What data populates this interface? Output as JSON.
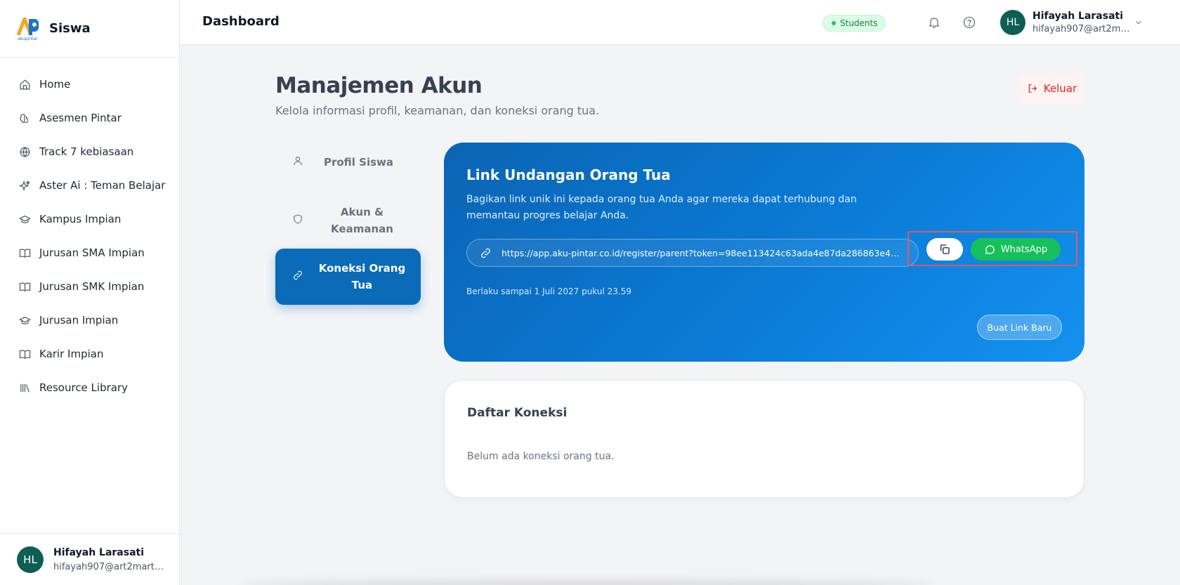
{
  "brand": {
    "name": "Siswa",
    "logo_text": "akupintar"
  },
  "sidebar": {
    "items": [
      {
        "label": "Home",
        "icon": "home-icon"
      },
      {
        "label": "Asesmen Pintar",
        "icon": "brain-icon"
      },
      {
        "label": "Track 7 kebiasaan",
        "icon": "globe-icon"
      },
      {
        "label": "Aster Ai : Teman Belajar",
        "icon": "sparkles-icon"
      },
      {
        "label": "Kampus Impian",
        "icon": "graduation-cap-icon"
      },
      {
        "label": "Jurusan SMA Impian",
        "icon": "book-icon"
      },
      {
        "label": "Jurusan SMK Impian",
        "icon": "book-icon"
      },
      {
        "label": "Jurusan Impian",
        "icon": "graduation-cap-icon"
      },
      {
        "label": "Karir Impian",
        "icon": "book-icon"
      },
      {
        "label": "Resource Library",
        "icon": "library-icon"
      }
    ],
    "user": {
      "initials": "HL",
      "name": "Hifayah Larasati",
      "email": "hifayah907@art2mart.c..."
    }
  },
  "header": {
    "title": "Dashboard",
    "role": "Students",
    "user": {
      "initials": "HL",
      "name": "Hifayah Larasati",
      "email": "hifayah907@art2mar..."
    }
  },
  "page": {
    "title": "Manajemen Akun",
    "subtitle": "Kelola informasi profil, keamanan, dan koneksi orang tua.",
    "logout_label": "Keluar"
  },
  "tabs": [
    {
      "label": "Profil Siswa",
      "icon": "user-icon",
      "active": false
    },
    {
      "label": "Akun & Keamanan",
      "icon": "shield-icon",
      "active": false
    },
    {
      "label": "Koneksi Orang Tua",
      "icon": "link-icon",
      "active": true
    }
  ],
  "invite": {
    "title": "Link Undangan Orang Tua",
    "description": "Bagikan link unik ini kepada orang tua Anda agar mereka dapat terhubung dan memantau progres belajar Anda.",
    "link": "https://app.aku-pintar.co.id/register/parent?token=98ee113424c63ada4e87da286863e42d8b...",
    "whatsapp_label": "WhatsApp",
    "expiry": "Berlaku sampai 1 Juli 2027 pukul 23.59",
    "new_link_label": "Buat Link Baru"
  },
  "connections": {
    "title": "Daftar Koneksi",
    "empty_text": "Belum ada koneksi orang tua."
  },
  "colors": {
    "primary": "#0b6bb8",
    "whatsapp": "#16c05a",
    "danger": "#dc2626",
    "badge_green": "#15803d"
  }
}
